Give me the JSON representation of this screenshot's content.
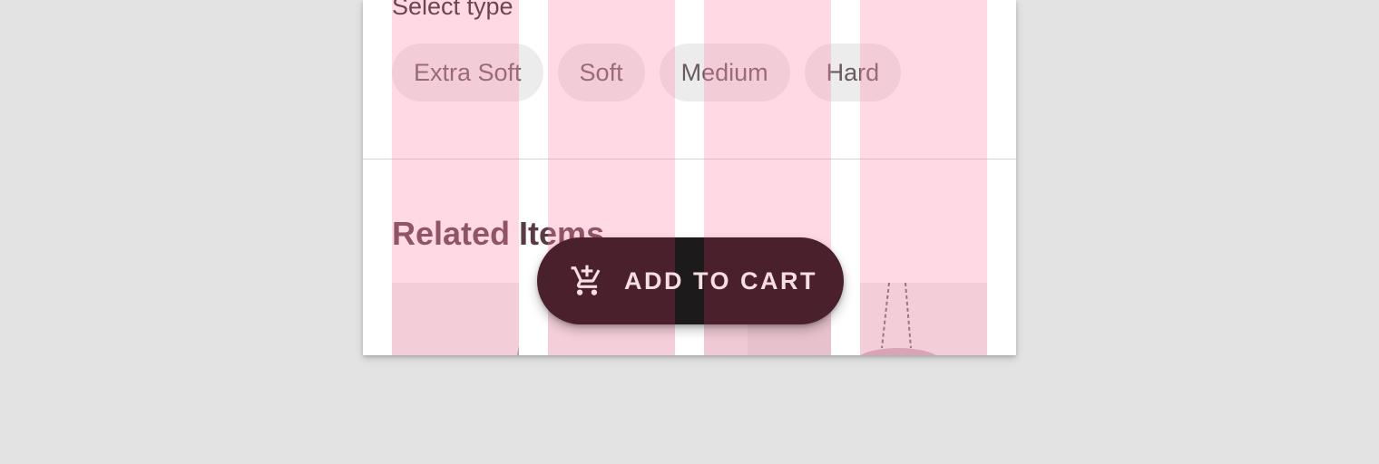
{
  "type_selector": {
    "label": "Select type",
    "options": [
      "Extra Soft",
      "Soft",
      "Medium",
      "Hard"
    ]
  },
  "related": {
    "title": "Related Items",
    "thumbnails": [
      "vase-image",
      "product-image",
      "product-image",
      "hanging-planter-image"
    ]
  },
  "fab": {
    "label": "ADD TO CART",
    "icon": "add-shopping-cart-icon"
  },
  "colors": {
    "background": "#e3e3e3",
    "fab": "#4a202d",
    "fab_text": "#f7dde4",
    "title": "#5c3a44",
    "chip": "#ececec",
    "grid_overlay": "#ff8caf"
  }
}
